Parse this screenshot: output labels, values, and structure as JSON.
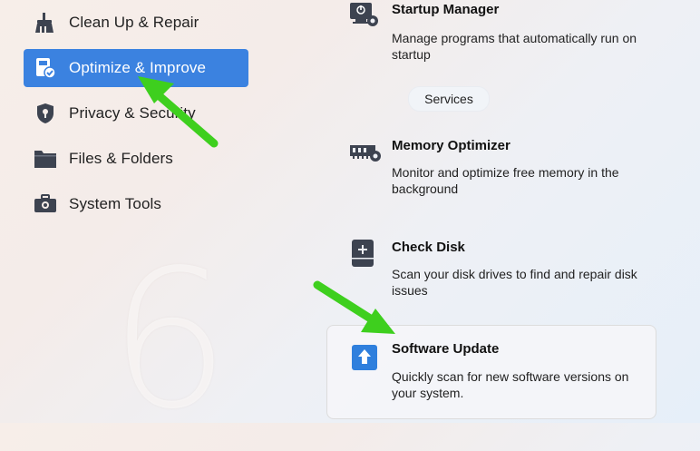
{
  "sidebar": {
    "items": [
      {
        "label": "Clean Up & Repair",
        "icon": "broom-icon"
      },
      {
        "label": "Optimize & Improve",
        "icon": "speed-optimize-icon",
        "active": true
      },
      {
        "label": "Privacy & Security",
        "icon": "shield-icon"
      },
      {
        "label": "Files & Folders",
        "icon": "folder-icon"
      },
      {
        "label": "System Tools",
        "icon": "toolbox-icon"
      }
    ],
    "decor_text": "6"
  },
  "main": {
    "cards": [
      {
        "title": "Startup Manager",
        "description": "Manage programs that automatically run on startup",
        "icon": "startup-gear-icon"
      },
      {
        "title": "Memory Optimizer",
        "description": "Monitor and optimize free memory in the background",
        "icon": "memory-icon"
      },
      {
        "title": "Check Disk",
        "description": "Scan your disk drives to find and repair disk issues",
        "icon": "disk-icon"
      },
      {
        "title": "Software Update",
        "description": "Quickly scan for new software versions on your system.",
        "icon": "update-arrow-icon"
      }
    ],
    "services_label": "Services"
  },
  "colors": {
    "accent": "#3b82e0",
    "annotation_arrow": "#3ecf1e",
    "icon_dark": "#3d4350"
  }
}
